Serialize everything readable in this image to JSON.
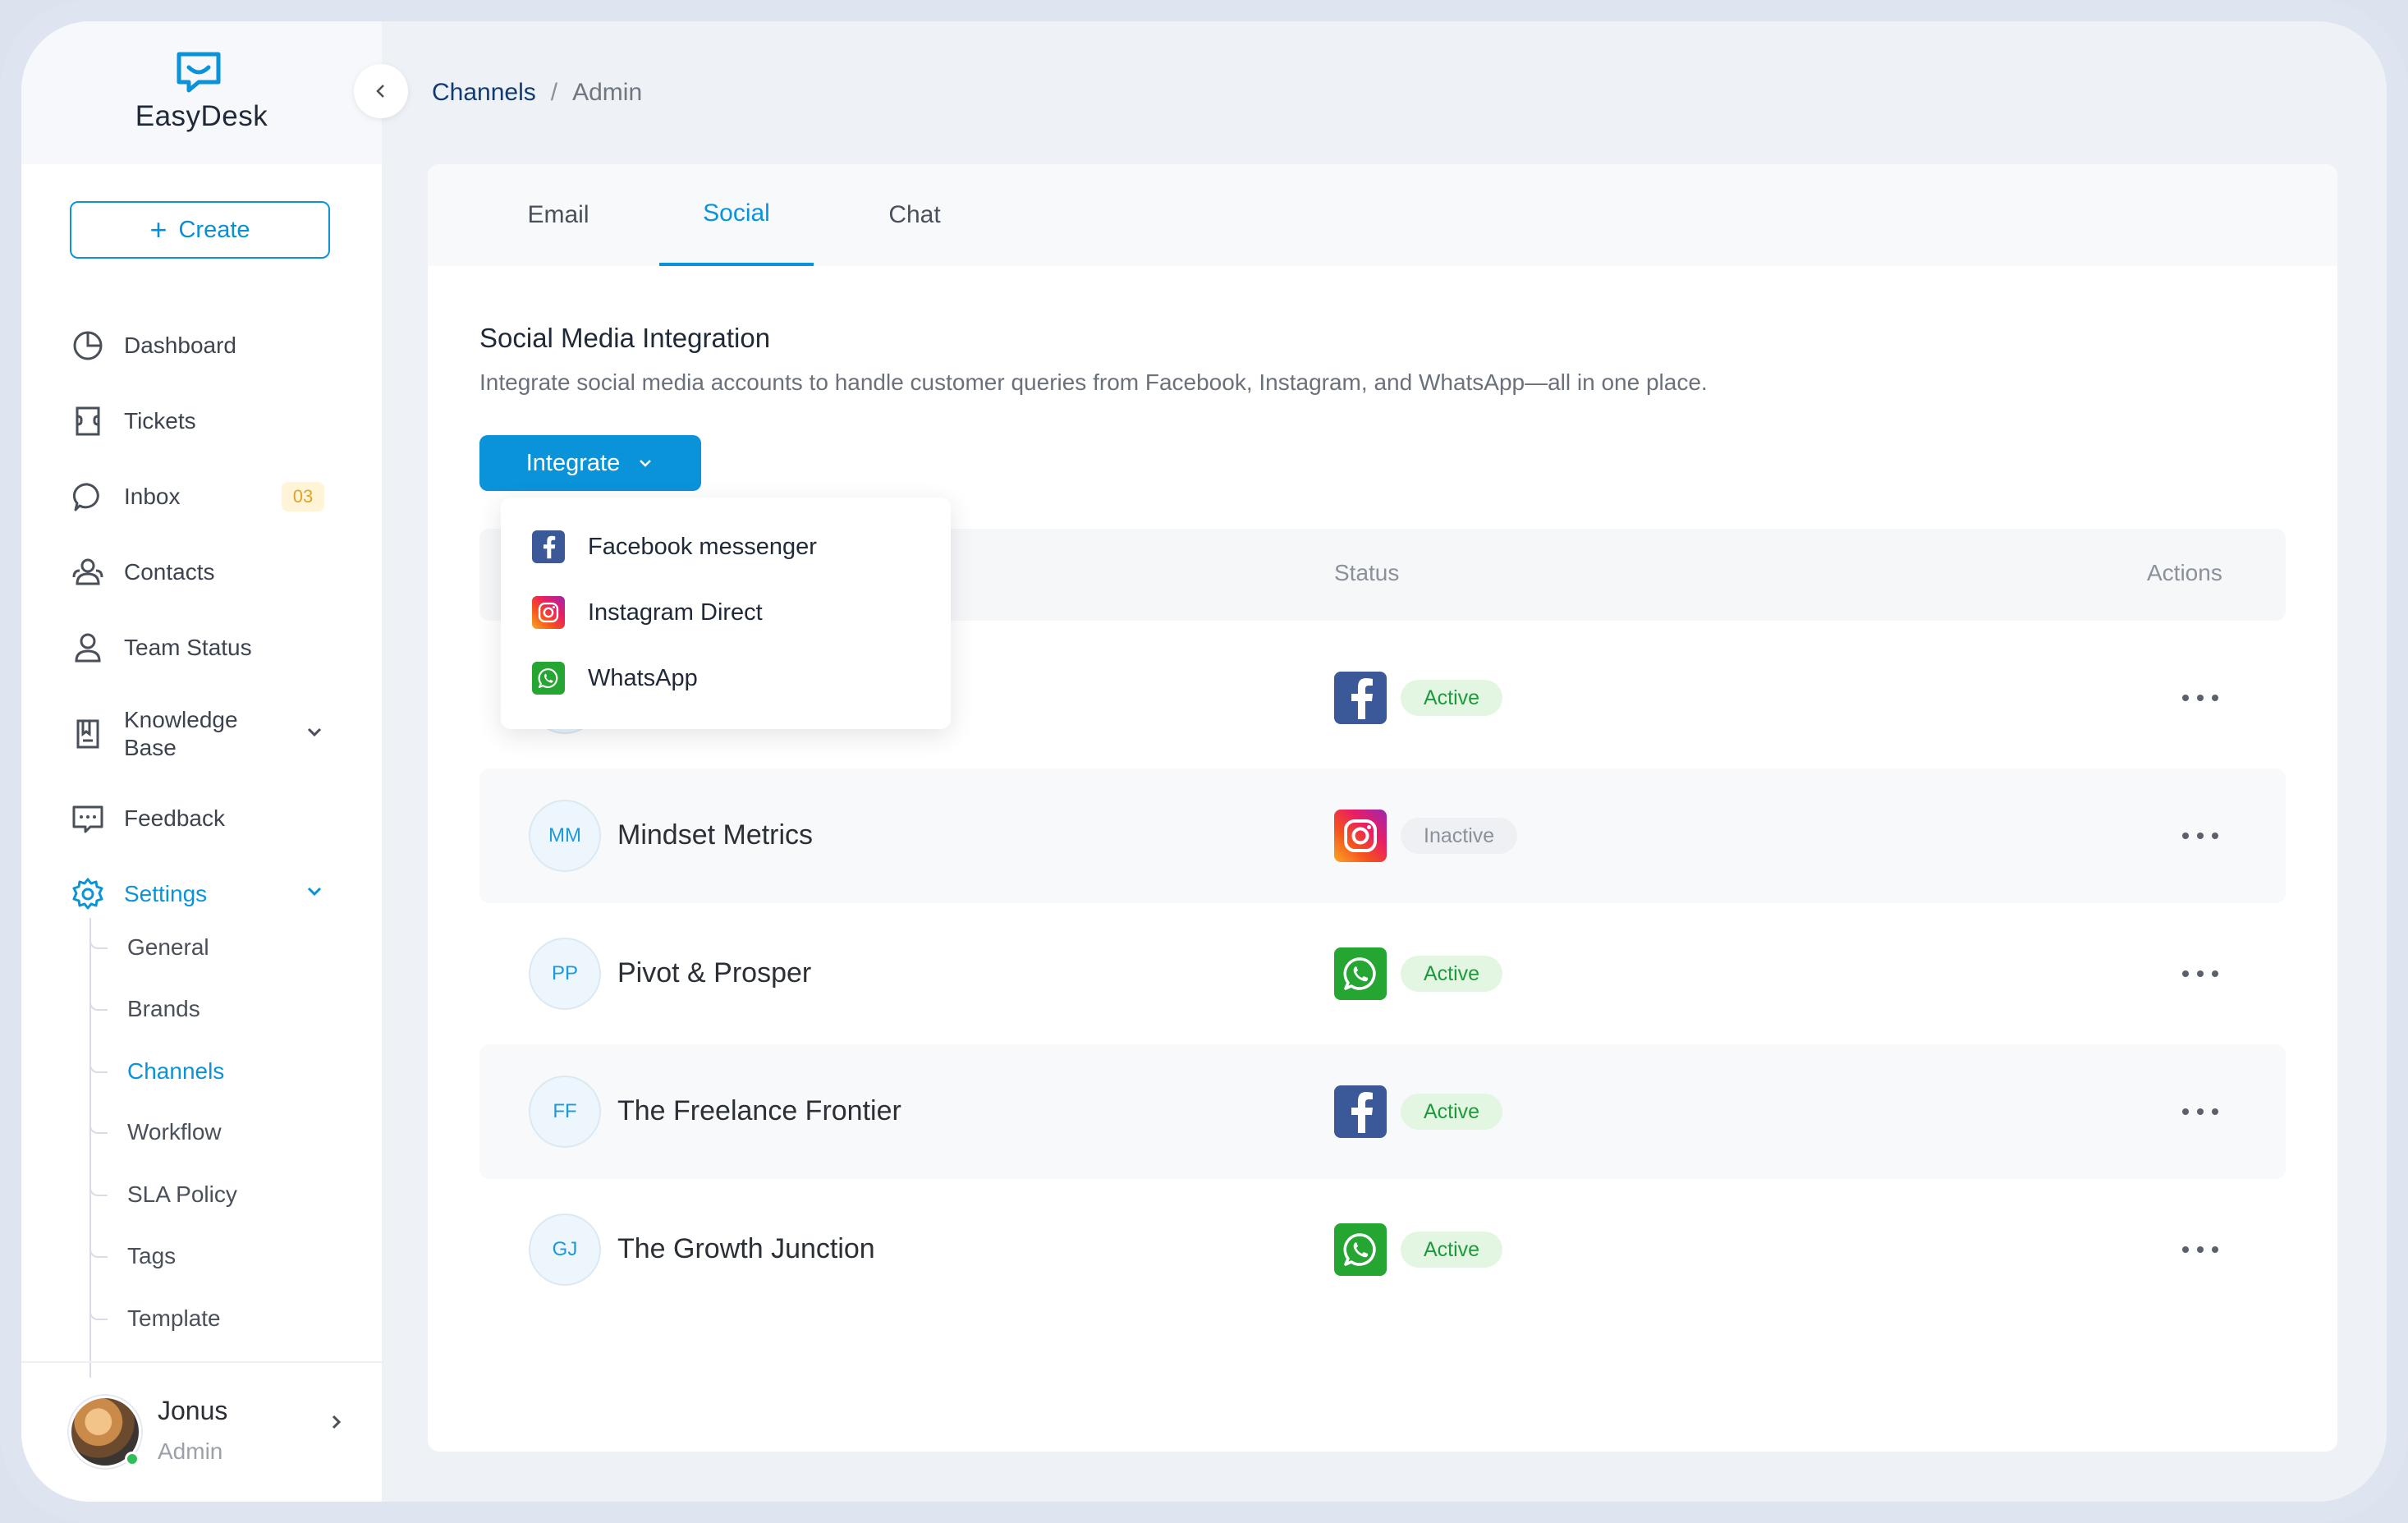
{
  "app": {
    "name": "EasyDesk"
  },
  "sidebar": {
    "create_label": "Create",
    "items": [
      {
        "label": "Dashboard",
        "icon": "pie-chart-icon"
      },
      {
        "label": "Tickets",
        "icon": "ticket-icon"
      },
      {
        "label": "Inbox",
        "icon": "chat-bubble-icon",
        "badge": "03"
      },
      {
        "label": "Contacts",
        "icon": "contacts-icon"
      },
      {
        "label": "Team Status",
        "icon": "user-icon"
      },
      {
        "label": "Knowledge Base",
        "icon": "book-icon"
      },
      {
        "label": "Feedback",
        "icon": "feedback-icon"
      },
      {
        "label": "Settings",
        "icon": "gear-icon",
        "active": true
      }
    ],
    "settings_sub": [
      "General",
      "Brands",
      "Channels",
      "Workflow",
      "SLA Policy",
      "Tags",
      "Template"
    ],
    "active_sub": "Channels",
    "user": {
      "name": "Jonus",
      "role": "Admin"
    }
  },
  "breadcrumb": {
    "link": "Channels",
    "separator": "/",
    "current": "Admin"
  },
  "tabs": [
    "Email",
    "Social",
    "Chat"
  ],
  "active_tab": "Social",
  "section": {
    "title": "Social Media Integration",
    "description": "Integrate social media accounts to handle customer queries from Facebook, Instagram, and WhatsApp—all in one place."
  },
  "integrate_label": "Integrate",
  "dropdown": [
    {
      "label": "Facebook messenger",
      "icon": "facebook-icon"
    },
    {
      "label": "Instagram Direct",
      "icon": "instagram-icon"
    },
    {
      "label": "WhatsApp",
      "icon": "whatsapp-icon"
    }
  ],
  "table": {
    "headers": {
      "status": "Status",
      "actions": "Actions"
    },
    "rows": [
      {
        "initials": "",
        "name": "",
        "channel": "facebook",
        "status": "Active"
      },
      {
        "initials": "MM",
        "name": "Mindset Metrics",
        "channel": "instagram",
        "status": "Inactive"
      },
      {
        "initials": "PP",
        "name": "Pivot & Prosper",
        "channel": "whatsapp",
        "status": "Active"
      },
      {
        "initials": "FF",
        "name": "The Freelance Frontier",
        "channel": "facebook",
        "status": "Active"
      },
      {
        "initials": "GJ",
        "name": "The Growth Junction",
        "channel": "whatsapp",
        "status": "Active"
      }
    ]
  },
  "colors": {
    "accent": "#0b93d9",
    "facebook": "#3b5998",
    "whatsapp": "#25a532",
    "active_text": "#1e9a3c",
    "inactive_text": "#8a919b"
  }
}
